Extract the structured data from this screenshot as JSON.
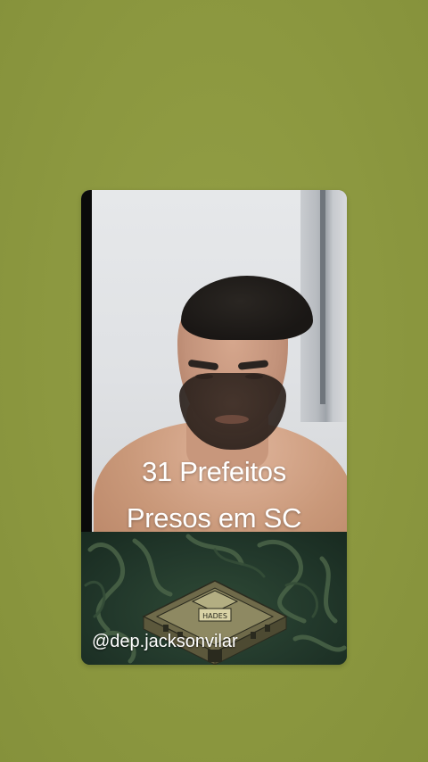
{
  "story": {
    "caption_line1": "31 Prefeitos",
    "caption_line2": "Presos em SC",
    "handle": "@dep.jacksonvilar",
    "sign_text": "HADES"
  },
  "colors": {
    "background": "#8e9a42",
    "caption_text": "#ffffff",
    "art_green": "#22382b"
  },
  "icons": {
    "building": "hades-building-illustration"
  }
}
